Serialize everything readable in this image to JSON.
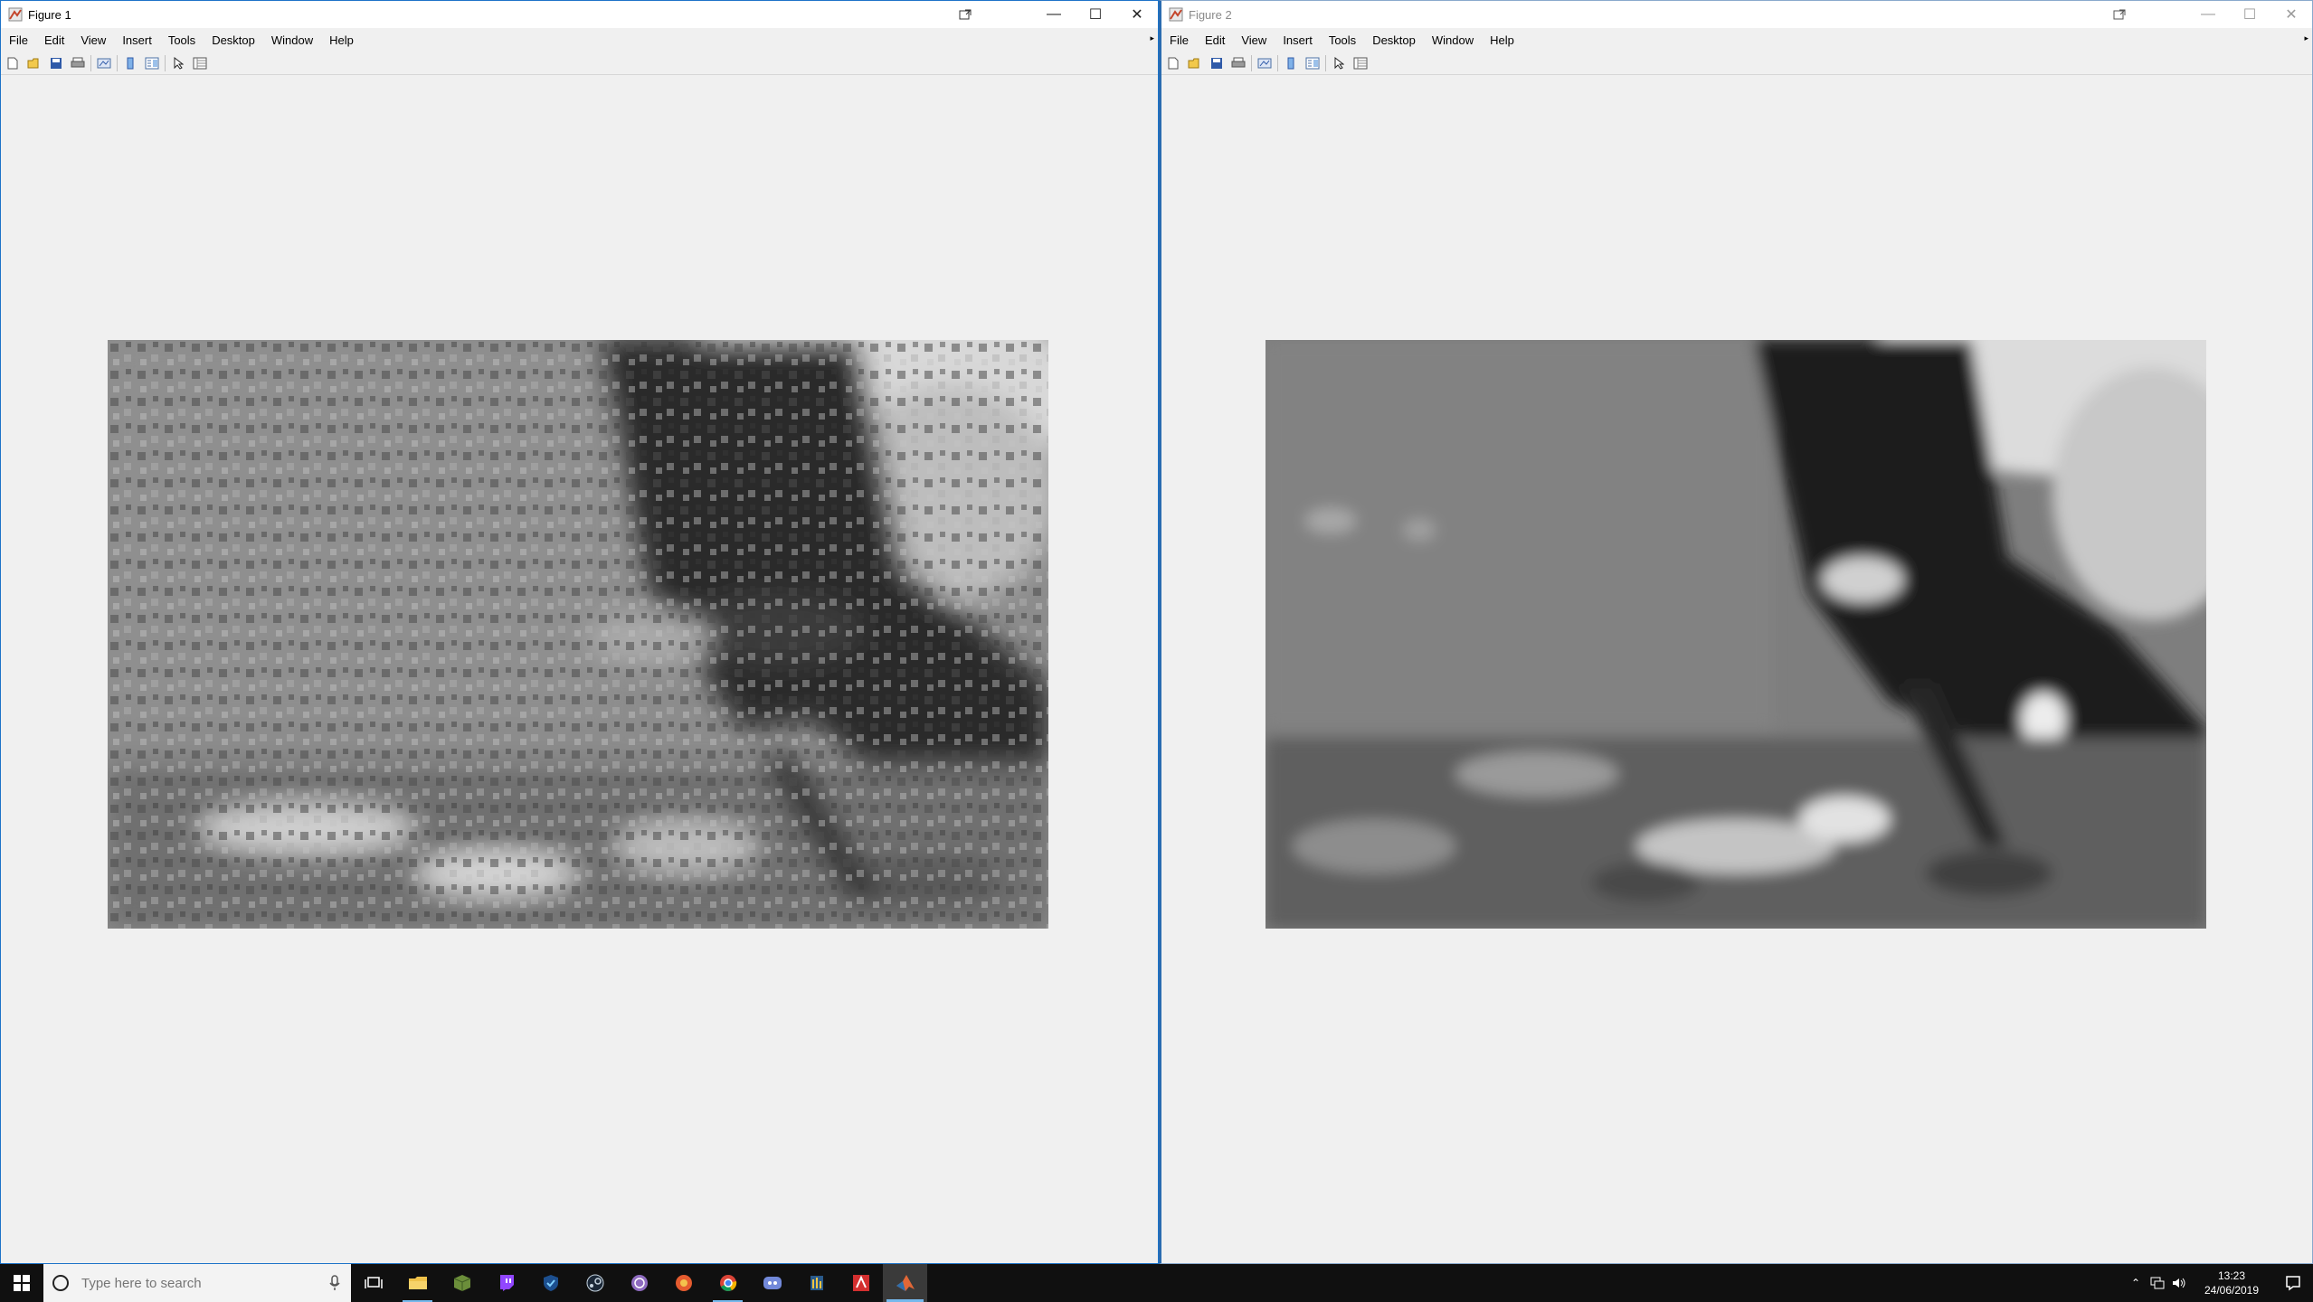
{
  "figures": [
    {
      "title": "Figure 1"
    },
    {
      "title": "Figure 2"
    }
  ],
  "menu": [
    "File",
    "Edit",
    "View",
    "Insert",
    "Tools",
    "Desktop",
    "Window",
    "Help"
  ],
  "window_controls": {
    "minimize": "—",
    "maximize": "☐",
    "close": "✕"
  },
  "taskbar": {
    "search_placeholder": "Type here to search",
    "apps": [
      "task-view",
      "file-explorer",
      "minecraft",
      "twitch",
      "vpn-shield",
      "steam",
      "app-purple",
      "firefox-like",
      "chrome",
      "discord",
      "app-yellow",
      "app-red",
      "matlab"
    ],
    "time": "13:23",
    "date": "24/06/2019"
  },
  "colors": {
    "window_bg": "#f0f0f0",
    "taskbar_bg": "#101010",
    "accent": "#76b9ed"
  }
}
